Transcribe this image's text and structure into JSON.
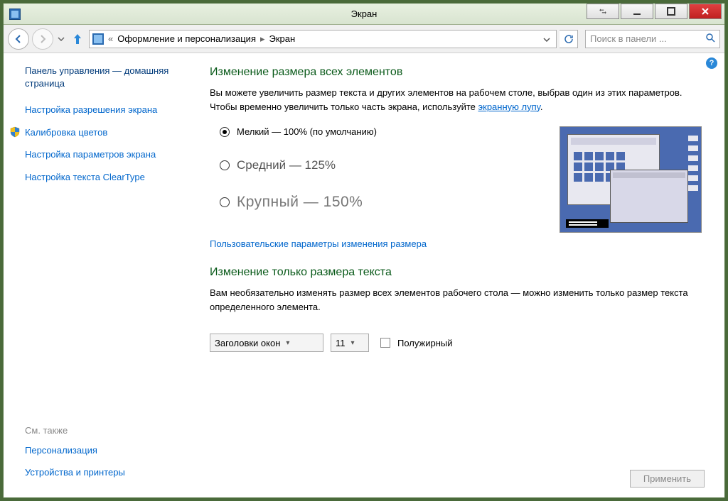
{
  "window": {
    "title": "Экран"
  },
  "breadcrumb": {
    "parent": "Оформление и персонализация",
    "current": "Экран"
  },
  "search": {
    "placeholder": "Поиск в панели ..."
  },
  "sidebar": {
    "home": "Панель управления — домашняя страница",
    "links": [
      "Настройка разрешения экрана",
      "Калибровка цветов",
      "Настройка параметров экрана",
      "Настройка текста ClearType"
    ],
    "see_also_label": "См. также",
    "see_also": [
      "Персонализация",
      "Устройства и принтеры"
    ]
  },
  "content": {
    "heading1": "Изменение размера всех элементов",
    "desc1_a": "Вы можете увеличить размер текста и других элементов на рабочем столе, выбрав один из этих параметров. Чтобы временно увеличить только часть экрана, используйте ",
    "desc1_link": "экранную лупу",
    "desc1_b": ".",
    "options": [
      {
        "label": "Мелкий — 100% (по умолчанию)",
        "checked": true
      },
      {
        "label": "Средний — 125%",
        "checked": false
      },
      {
        "label": "Крупный — 150%",
        "checked": false
      }
    ],
    "custom_link": "Пользовательские параметры изменения размера",
    "heading2": "Изменение только размера текста",
    "desc2": "Вам необязательно изменять размер всех элементов рабочего стола — можно изменить только размер текста определенного элемента.",
    "element_select": "Заголовки окон",
    "size_select": "11",
    "bold_label": "Полужирный",
    "apply": "Применить"
  }
}
